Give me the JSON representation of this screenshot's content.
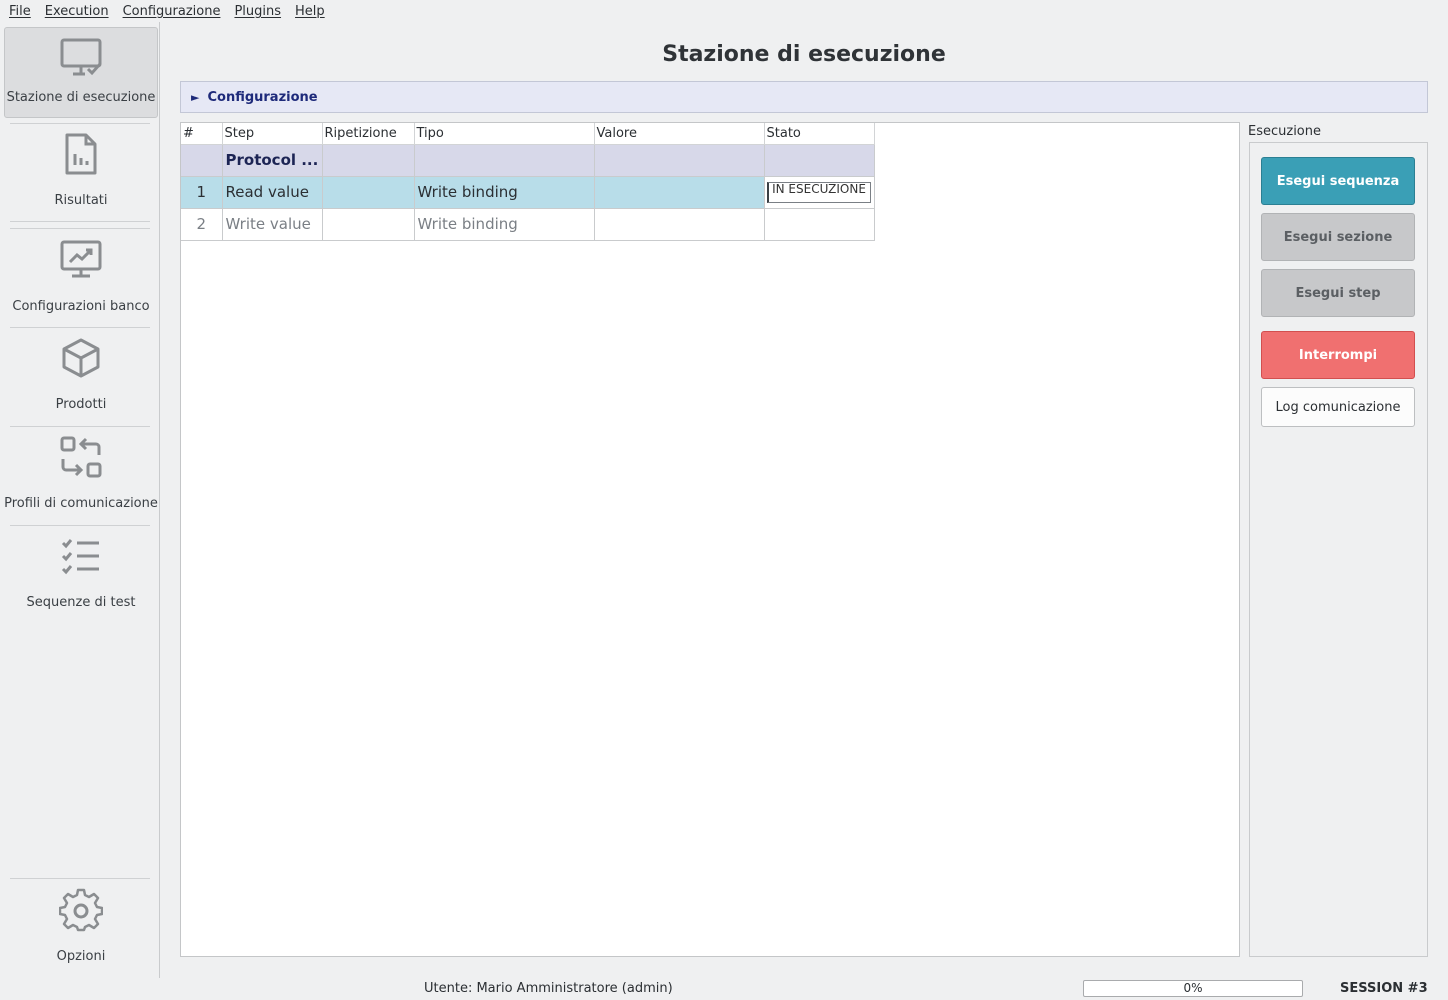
{
  "menu": [
    "File",
    "Execution",
    "Configurazione",
    "Plugins",
    "Help"
  ],
  "sidebar": {
    "items": [
      {
        "label": "Stazione di esecuzione",
        "icon": "monitor-check-icon",
        "active": true
      },
      {
        "label": "Risultati",
        "icon": "report-icon"
      },
      {
        "label": "Configurazioni banco",
        "icon": "monitor-chart-icon"
      },
      {
        "label": "Prodotti",
        "icon": "cube-icon"
      },
      {
        "label": "Profili di comunicazione",
        "icon": "exchange-icon"
      },
      {
        "label": "Sequenze di test",
        "icon": "checklist-icon"
      }
    ],
    "options": {
      "label": "Opzioni",
      "icon": "gear-icon"
    }
  },
  "page_title": "Stazione di esecuzione",
  "config_section": {
    "label": "Configurazione",
    "expanded": false
  },
  "table": {
    "columns": [
      "#",
      "Step",
      "Ripetizione",
      "Tipo",
      "Valore",
      "Stato"
    ],
    "group_row": {
      "step": "Protocol ..."
    },
    "rows": [
      {
        "num": "1",
        "step": "Read value",
        "ripetizione": "",
        "tipo": "Write binding",
        "valore": "",
        "stato": "IN ESECUZIONE",
        "selected": true
      },
      {
        "num": "2",
        "step": "Write value",
        "ripetizione": "",
        "tipo": "Write binding",
        "valore": "",
        "stato": ""
      }
    ]
  },
  "execution": {
    "title": "Esecuzione",
    "buttons": {
      "run_sequence": "Esegui sequenza",
      "run_section": "Esegui sezione",
      "run_step": "Esegui step",
      "stop": "Interrompi",
      "comm_log": "Log comunicazione"
    }
  },
  "status": {
    "user": "Utente: Mario Amministratore (admin)",
    "progress_text": "0%",
    "progress": 0,
    "session": "SESSION #3"
  },
  "colors": {
    "accent": "#3a9fb6",
    "danger": "#f07070",
    "selected_row": "#b8dde9",
    "group_row": "#d7d8e9"
  }
}
